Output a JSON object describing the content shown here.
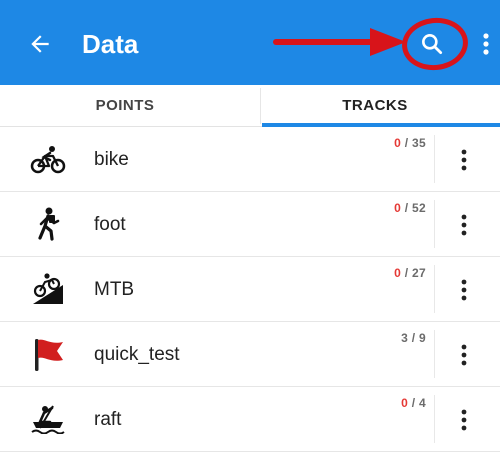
{
  "appbar": {
    "title": "Data",
    "background": "#1e88e5",
    "back_icon": "arrow-left-icon",
    "search_icon": "search-icon",
    "overflow_icon": "more-vert-icon"
  },
  "annotation": {
    "color": "#d8141a",
    "shapes": [
      "arrow",
      "circle"
    ]
  },
  "tabs": [
    {
      "label": "POINTS",
      "active": false
    },
    {
      "label": "TRACKS",
      "active": true
    }
  ],
  "accent": "#1e88e5",
  "tracks": [
    {
      "name": "bike",
      "icon": "bicycle-icon",
      "visible": "0",
      "total": "35",
      "visible_highlight": true
    },
    {
      "name": "foot",
      "icon": "hiker-icon",
      "visible": "0",
      "total": "52",
      "visible_highlight": true
    },
    {
      "name": "MTB",
      "icon": "mountain-bike-icon",
      "visible": "0",
      "total": "27",
      "visible_highlight": true
    },
    {
      "name": "quick_test",
      "icon": "red-flag-icon",
      "visible": "3",
      "total": "9",
      "visible_highlight": false
    },
    {
      "name": "raft",
      "icon": "raft-icon",
      "visible": "0",
      "total": "4",
      "visible_highlight": true
    }
  ],
  "count_separator": " / ",
  "item_menu_icon": "more-vert-icon"
}
